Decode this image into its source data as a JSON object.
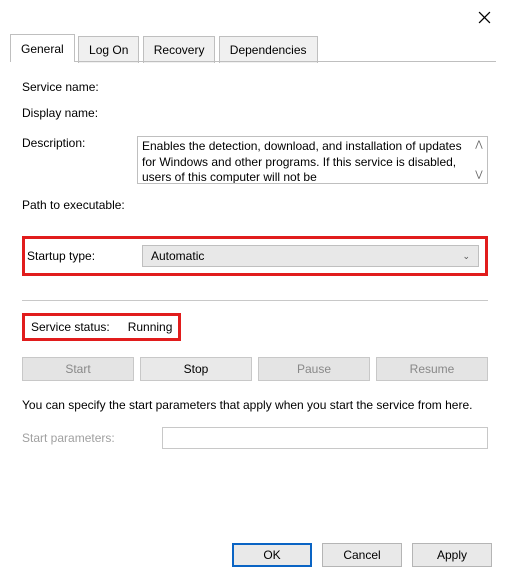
{
  "tabs": {
    "general": "General",
    "logon": "Log On",
    "recovery": "Recovery",
    "dependencies": "Dependencies"
  },
  "labels": {
    "service_name": "Service name:",
    "display_name": "Display name:",
    "description": "Description:",
    "path": "Path to executable:",
    "startup_type": "Startup type:",
    "service_status": "Service status:",
    "start_parameters": "Start parameters:"
  },
  "values": {
    "service_name": "",
    "display_name": "",
    "description": "Enables the detection, download, and installation of updates for Windows and other programs. If this service is disabled, users of this computer will not be",
    "path": "",
    "startup_type": "Automatic",
    "service_status": "Running",
    "start_parameters": ""
  },
  "buttons": {
    "start": "Start",
    "stop": "Stop",
    "pause": "Pause",
    "resume": "Resume",
    "ok": "OK",
    "cancel": "Cancel",
    "apply": "Apply"
  },
  "hint": "You can specify the start parameters that apply when you start the service from here."
}
